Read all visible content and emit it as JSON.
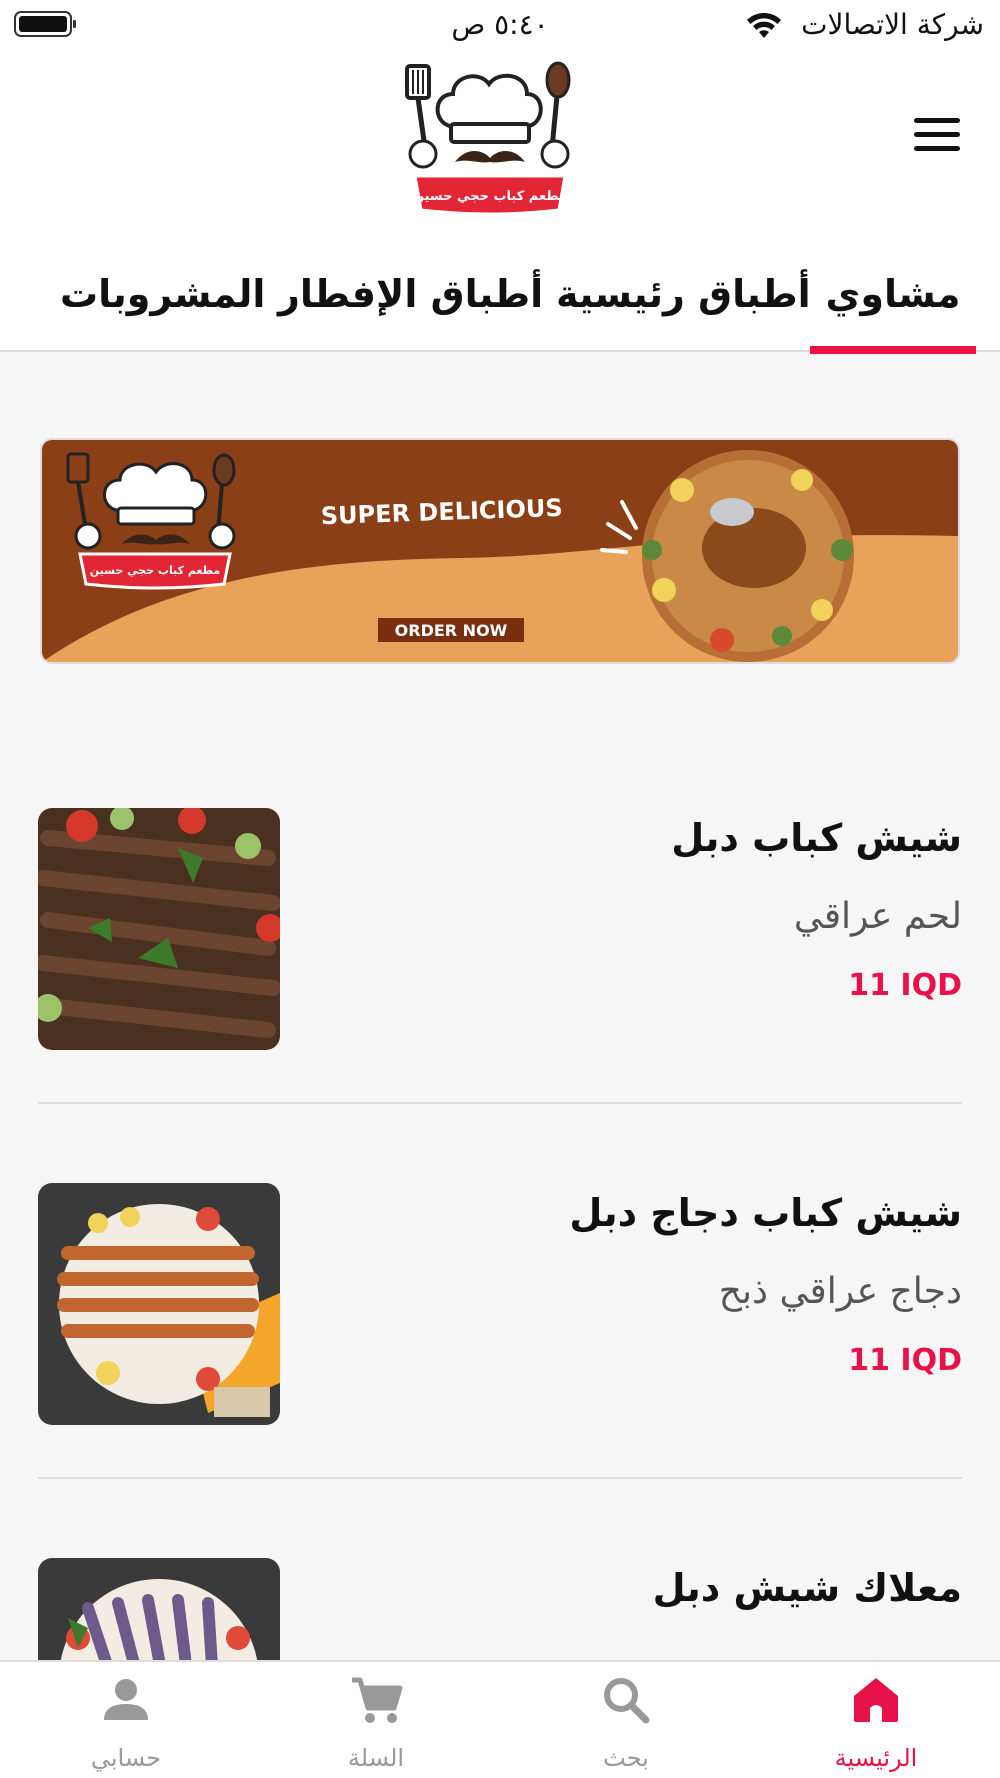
{
  "status_bar": {
    "time": "٥:٤٠ ص",
    "carrier": "شركة الاتصالات"
  },
  "header": {
    "logo_text": "مطعم كباب حجي حسين"
  },
  "tabs": [
    {
      "label": "مشاوي",
      "active": true
    },
    {
      "label": "أطباق رئيسية",
      "active": false
    },
    {
      "label": "أطباق الإفطار",
      "active": false
    },
    {
      "label": "المشروبات",
      "active": false
    }
  ],
  "banner": {
    "headline": "SUPER DELICIOUS",
    "cta": "ORDER NOW",
    "logo_text": "مطعم كباب حجي حسين",
    "colors": {
      "brown": "#8a3f16",
      "orange": "#e9a25a",
      "cta_bg": "#7a2e10"
    }
  },
  "products": [
    {
      "name": "شيش كباب دبل",
      "description": "لحم عراقي",
      "price": "11 IQD"
    },
    {
      "name": "شيش كباب دجاج دبل",
      "description": "دجاج عراقي ذبح",
      "price": "11 IQD"
    },
    {
      "name": "معلاك شيش دبل",
      "description": "",
      "price": ""
    }
  ],
  "bottom_nav": {
    "items": [
      {
        "label": "الرئيسية",
        "icon": "home-icon",
        "active": true
      },
      {
        "label": "بحث",
        "icon": "search-icon",
        "active": false
      },
      {
        "label": "السلة",
        "icon": "cart-icon",
        "active": false
      },
      {
        "label": "حسابي",
        "icon": "account-icon",
        "active": false
      }
    ]
  },
  "colors": {
    "accent": "#e8124a",
    "tab_indicator": "#f0123f",
    "background": "#f6f6f6"
  }
}
